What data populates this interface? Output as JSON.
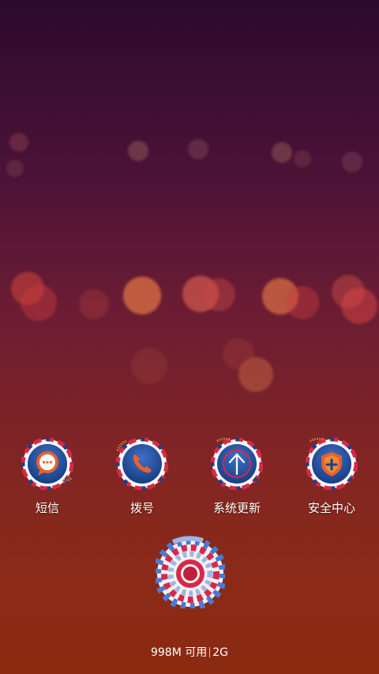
{
  "apps": [
    {
      "label": "短信",
      "icon": "message-icon"
    },
    {
      "label": "拨号",
      "icon": "phone-icon"
    },
    {
      "label": "系统更新",
      "icon": "update-arrow-icon"
    },
    {
      "label": "安全中心",
      "icon": "security-shield-icon"
    }
  ],
  "center_button": {
    "icon": "spiral-swirl-icon"
  },
  "status": {
    "memory": "998M 可用",
    "network": "2G"
  },
  "colors": {
    "ring_navy": "#1b3f8a",
    "ring_red": "#d8284a",
    "ring_white": "#f4f4f4",
    "accent_orange": "#e8612c"
  }
}
